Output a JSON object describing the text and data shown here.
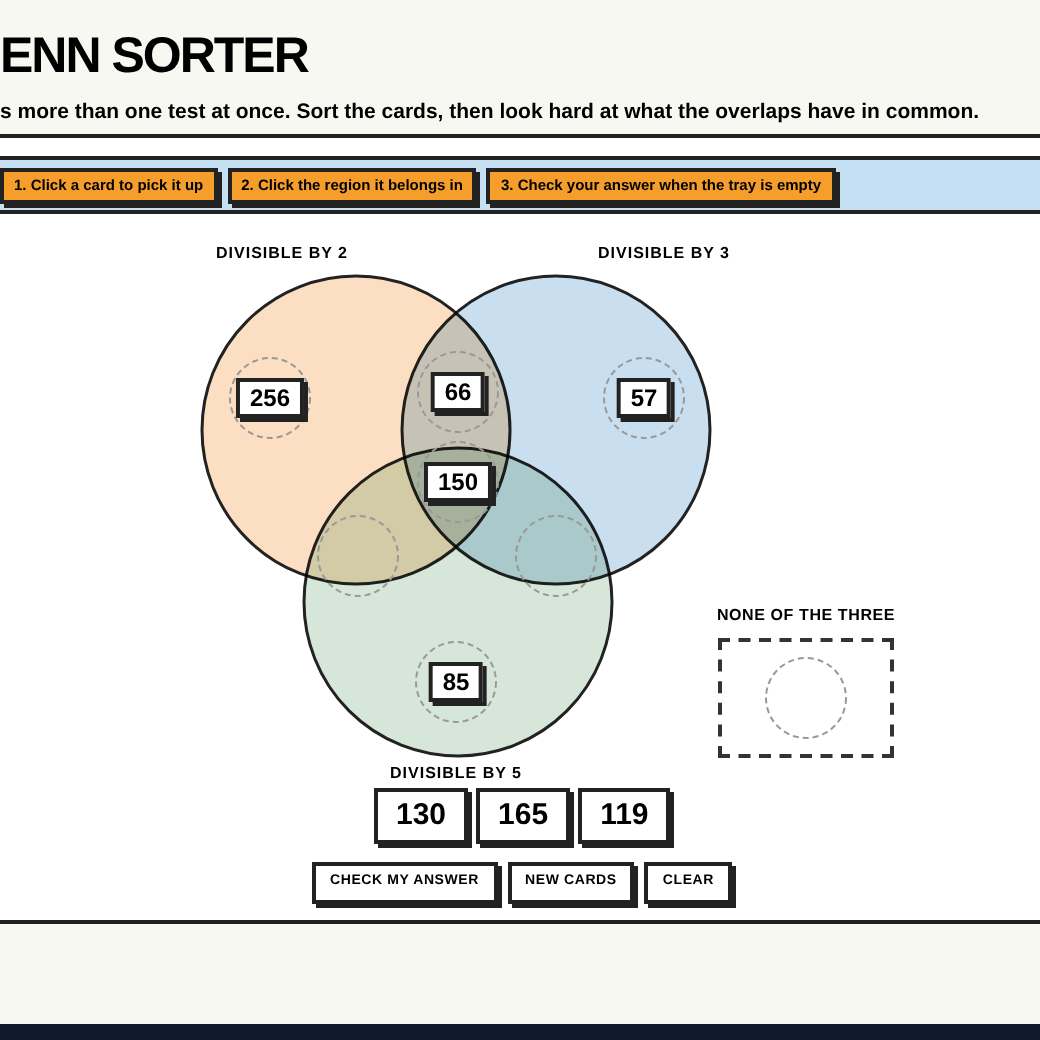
{
  "header": {
    "title": "ENN SORTER",
    "subtitle": "s more than one test at once. Sort the cards, then look hard at what the overlaps have in common."
  },
  "steps": [
    "1. Click a card to pick it up",
    "2. Click the region it belongs in",
    "3. Check your answer when the tray is empty"
  ],
  "sets": [
    {
      "label": "DIVISIBLE BY 2",
      "color": "#fcdfc2"
    },
    {
      "label": "DIVISIBLE BY 3",
      "color": "#c9deee"
    },
    {
      "label": "DIVISIBLE BY 5",
      "color": "#d6e7da"
    }
  ],
  "slots": [
    {
      "filled": true,
      "card": "256"
    },
    {
      "filled": true,
      "card": "66"
    },
    {
      "filled": true,
      "card": "57"
    },
    {
      "filled": true,
      "card": "150"
    },
    {
      "filled": false
    },
    {
      "filled": false
    },
    {
      "filled": true,
      "card": "85"
    }
  ],
  "none_zone": {
    "label": "NONE OF THE THREE"
  },
  "tray": [
    "130",
    "165",
    "119"
  ],
  "buttons": [
    "CHECK MY ANSWER",
    "NEW CARDS",
    "CLEAR"
  ]
}
